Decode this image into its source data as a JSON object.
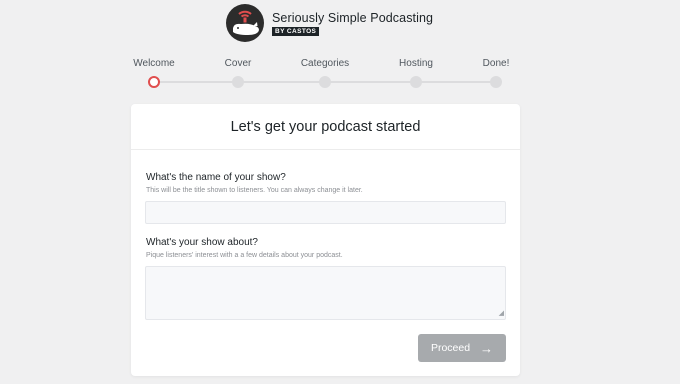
{
  "brand": {
    "title": "Seriously Simple Podcasting",
    "subtitle": "BY CASTOS",
    "logo_icon": "whale-podcast-logo"
  },
  "steps": [
    {
      "label": "Welcome",
      "active": true
    },
    {
      "label": "Cover",
      "active": false
    },
    {
      "label": "Categories",
      "active": false
    },
    {
      "label": "Hosting",
      "active": false
    },
    {
      "label": "Done!",
      "active": false
    }
  ],
  "card": {
    "title": "Let's get your podcast started",
    "show_name": {
      "label": "What's the name of your show?",
      "help": "This will be the title shown to listeners. You can always change it later.",
      "value": "",
      "placeholder": ""
    },
    "show_about": {
      "label": "What's your show about?",
      "help": "Pique listeners' interest with a a few details about your podcast.",
      "value": "",
      "placeholder": ""
    },
    "proceed_label": "Proceed",
    "proceed_icon": "arrow-right-icon"
  },
  "colors": {
    "active_step": "#e04e4e",
    "proceed_disabled": "#a7aaad",
    "page_bg": "#f0f0f1"
  }
}
